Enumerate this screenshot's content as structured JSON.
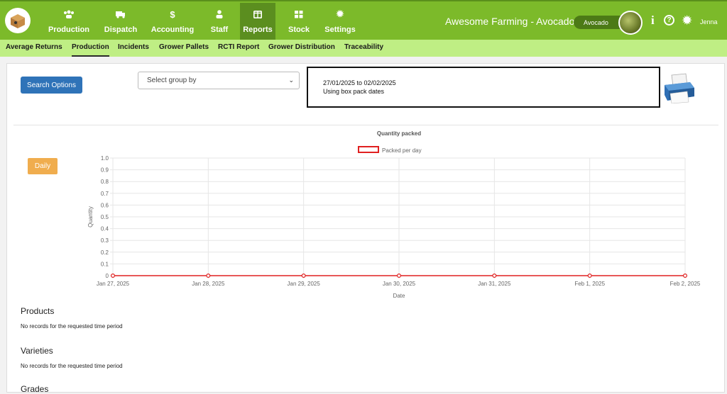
{
  "topbar": {
    "nav": [
      {
        "label": "Production",
        "icon": "users-icon"
      },
      {
        "label": "Dispatch",
        "icon": "truck-icon"
      },
      {
        "label": "Accounting",
        "icon": "dollar-icon"
      },
      {
        "label": "Staff",
        "icon": "person-icon"
      },
      {
        "label": "Reports",
        "icon": "report-icon"
      },
      {
        "label": "Stock",
        "icon": "grid-icon"
      },
      {
        "label": "Settings",
        "icon": "gear-icon"
      }
    ],
    "brand": "Awesome Farming - Avocados",
    "commodity": "Avocado",
    "user": "Jenna"
  },
  "subnav": [
    "Average Returns",
    "Production",
    "Incidents",
    "Grower Pallets",
    "RCTI Report",
    "Grower Distribution",
    "Traceability"
  ],
  "controls": {
    "search_label": "Search Options",
    "group_by_placeholder": "Select group by",
    "date_range": "27/01/2025 to 02/02/2025",
    "date_basis": "Using box pack dates",
    "daily_label": "Daily"
  },
  "chart_data": {
    "type": "line",
    "title": "Quantity packed",
    "xlabel": "Date",
    "ylabel": "Quantity",
    "categories": [
      "Jan 27, 2025",
      "Jan 28, 2025",
      "Jan 29, 2025",
      "Jan 30, 2025",
      "Jan 31, 2025",
      "Feb 1, 2025",
      "Feb 2, 2025"
    ],
    "series": [
      {
        "name": "Packed per day",
        "values": [
          0,
          0,
          0,
          0,
          0,
          0,
          0
        ],
        "color": "#e02020"
      }
    ],
    "ylim": [
      0,
      1.0
    ],
    "yticks": [
      "0",
      "0.1",
      "0.2",
      "0.3",
      "0.4",
      "0.5",
      "0.6",
      "0.7",
      "0.8",
      "0.9",
      "1.0"
    ],
    "grid": true,
    "legend": "top"
  },
  "sections": [
    {
      "title": "Products",
      "text": "No records for the requested time period"
    },
    {
      "title": "Varieties",
      "text": "No records for the requested time period"
    },
    {
      "title": "Grades",
      "text": ""
    }
  ],
  "colors": {
    "nav_green": "#7cba2a",
    "subnav_green": "#bfee84",
    "accent_blue": "#2f73b8",
    "daily_orange": "#f0ad4e"
  }
}
